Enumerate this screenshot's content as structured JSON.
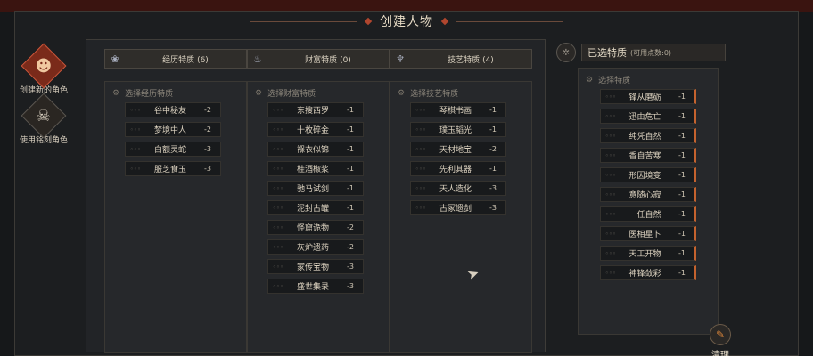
{
  "window": {
    "title": "创建人物"
  },
  "sidebar": [
    {
      "label": "创建新的角色",
      "icon": "mask-icon"
    },
    {
      "label": "使用铭刻角色",
      "icon": "skull-icon"
    }
  ],
  "columns": [
    {
      "header": "经历特质",
      "count": "(6)",
      "icon": "lotus-icon",
      "box_title": "选择经历特质",
      "traits": [
        {
          "name": "谷中秘友",
          "cost": "-2"
        },
        {
          "name": "梦境中人",
          "cost": "-2"
        },
        {
          "name": "白额灵蛇",
          "cost": "-3"
        },
        {
          "name": "服芝食玉",
          "cost": "-3"
        }
      ]
    },
    {
      "header": "财富特质",
      "count": "(0)",
      "icon": "bowl-icon",
      "box_title": "选择财富特质",
      "traits": [
        {
          "name": "东搜西罗",
          "cost": "-1"
        },
        {
          "name": "十枚碎金",
          "cost": "-1"
        },
        {
          "name": "褓衣似锦",
          "cost": "-1"
        },
        {
          "name": "桂酒椒浆",
          "cost": "-1"
        },
        {
          "name": "驰马试剑",
          "cost": "-1"
        },
        {
          "name": "泥封古罐",
          "cost": "-1"
        },
        {
          "name": "怪窟诡物",
          "cost": "-2"
        },
        {
          "name": "灰炉遗药",
          "cost": "-2"
        },
        {
          "name": "家传宝物",
          "cost": "-3"
        },
        {
          "name": "盛世集录",
          "cost": "-3"
        }
      ]
    },
    {
      "header": "技艺特质",
      "count": "(4)",
      "icon": "cup-icon",
      "box_title": "选择技艺特质",
      "traits": [
        {
          "name": "琴棋书画",
          "cost": "-1"
        },
        {
          "name": "璞玉韬光",
          "cost": "-1"
        },
        {
          "name": "天材地宝",
          "cost": "-2"
        },
        {
          "name": "先利其器",
          "cost": "-1"
        },
        {
          "name": "天人造化",
          "cost": "-3"
        },
        {
          "name": "古冢遗剑",
          "cost": "-3"
        }
      ]
    }
  ],
  "selected": {
    "title": "已选特质",
    "points": "(可用点数:0)",
    "box_title": "选择特质",
    "traits": [
      {
        "name": "锋从磨砺",
        "cost": "-1"
      },
      {
        "name": "迅由危亡",
        "cost": "-1"
      },
      {
        "name": "纯凭自然",
        "cost": "-1"
      },
      {
        "name": "香自苦寒",
        "cost": "-1"
      },
      {
        "name": "形因境变",
        "cost": "-1"
      },
      {
        "name": "意随心寂",
        "cost": "-1"
      },
      {
        "name": "一任自然",
        "cost": "-1"
      },
      {
        "name": "医相星卜",
        "cost": "-1"
      },
      {
        "name": "天工开物",
        "cost": "-1"
      },
      {
        "name": "神锋敛彩",
        "cost": "-1"
      }
    ]
  },
  "actions": {
    "cleanup": "清理"
  },
  "colors": {
    "accent": "#c4622e",
    "active": "#7a2a1a"
  }
}
